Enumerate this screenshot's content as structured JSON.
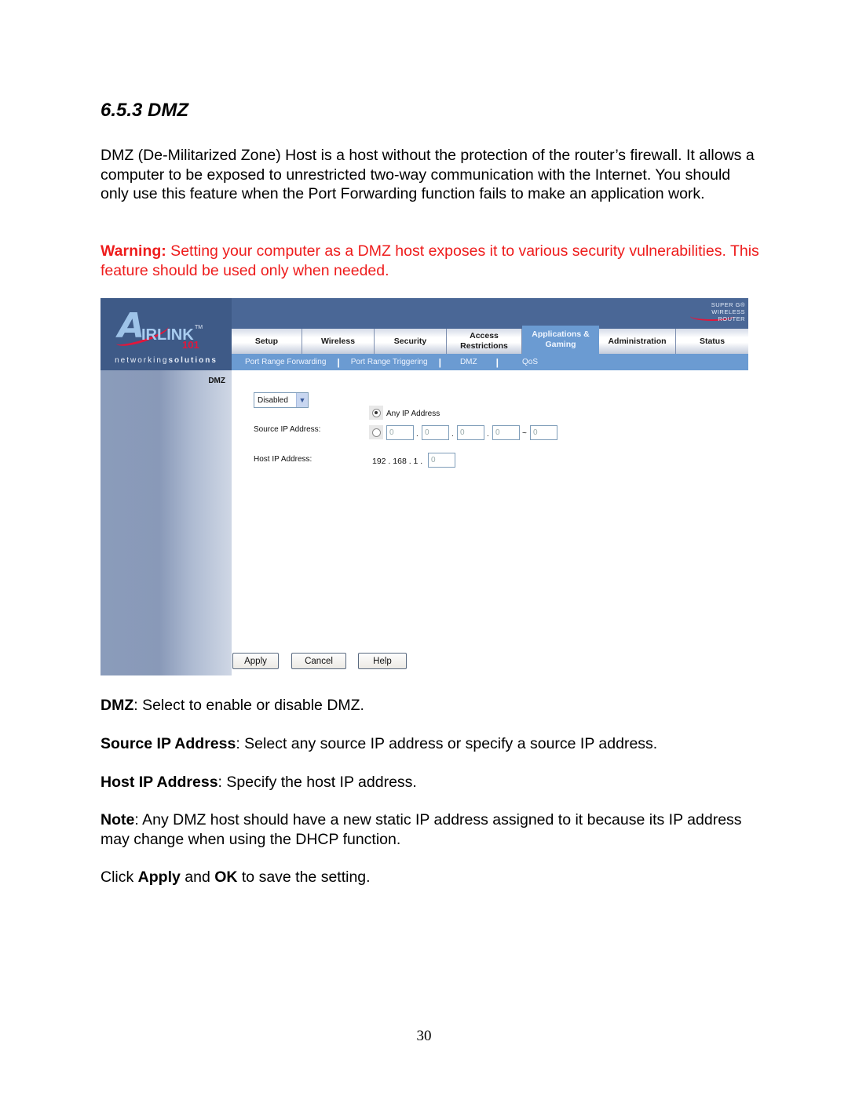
{
  "heading": "6.5.3 DMZ",
  "intro": "DMZ (De-Militarized Zone) Host is a host without the protection of the router’s firewall. It allows a computer to be exposed to unrestricted two-way communication with the Internet. You should only use this feature when the Port Forwarding function fails to make an application work.",
  "warning": {
    "label": "Warning:",
    "text": " Setting your computer as a DMZ host exposes it to various security vulnerabilities. This feature should be used only when needed.",
    "color": "#ee1c1c"
  },
  "router": {
    "logo": {
      "letter": "A",
      "brand": "IRLINK",
      "tm": "TM",
      "number": "101",
      "tagline_bold": "networking",
      "tagline_rest": "solutions"
    },
    "badge": {
      "line1": "SUPER G®",
      "line2": "WIRELESS ROUTER"
    },
    "tabs": [
      {
        "label": "Setup"
      },
      {
        "label": "Wireless"
      },
      {
        "label": "Security"
      },
      {
        "label": "Access Restrictions"
      },
      {
        "label": "Applications & Gaming",
        "active": true
      },
      {
        "label": "Administration"
      },
      {
        "label": "Status"
      }
    ],
    "subnav": [
      {
        "label": "Port Range Forwarding"
      },
      {
        "label": "Port Range Triggering"
      },
      {
        "label": "DMZ",
        "active": true
      },
      {
        "label": "QoS"
      }
    ],
    "subnav_separator": "|",
    "section_label": "DMZ",
    "dmz_select": {
      "value": "Disabled",
      "arrow": "⌄"
    },
    "source_ip_label": "Source IP Address:",
    "any_ip_label": "Any IP Address",
    "any_ip_selected": true,
    "source_ip_fields": [
      "0",
      "0",
      "0",
      "0"
    ],
    "source_ip_range_end": "0",
    "dot": ".",
    "tilde": "~",
    "host_ip_label": "Host IP Address:",
    "host_ip_prefix": "192 . 168 . 1 .",
    "host_ip_last": "0",
    "buttons": {
      "apply": "Apply",
      "cancel": "Cancel",
      "help": "Help"
    },
    "colors": {
      "header": "#4a6796",
      "accent": "#6b9bd2",
      "logo_red": "#e3163b"
    }
  },
  "descriptions": {
    "dmz": {
      "term": "DMZ",
      "text": ": Select to enable or disable DMZ."
    },
    "source": {
      "term": "Source IP Address",
      "text": ": Select any source IP address or specify a source IP address."
    },
    "host": {
      "term": "Host IP Address",
      "text": ": Specify the host IP address."
    },
    "note": {
      "term": "Note",
      "text": ": Any DMZ host should have a new static IP address assigned to it because its IP address may change when using the DHCP function."
    },
    "click": {
      "pre": "Click ",
      "apply": "Apply",
      "mid": " and ",
      "ok": "OK",
      "post": " to save the setting."
    }
  },
  "page_number": "30"
}
